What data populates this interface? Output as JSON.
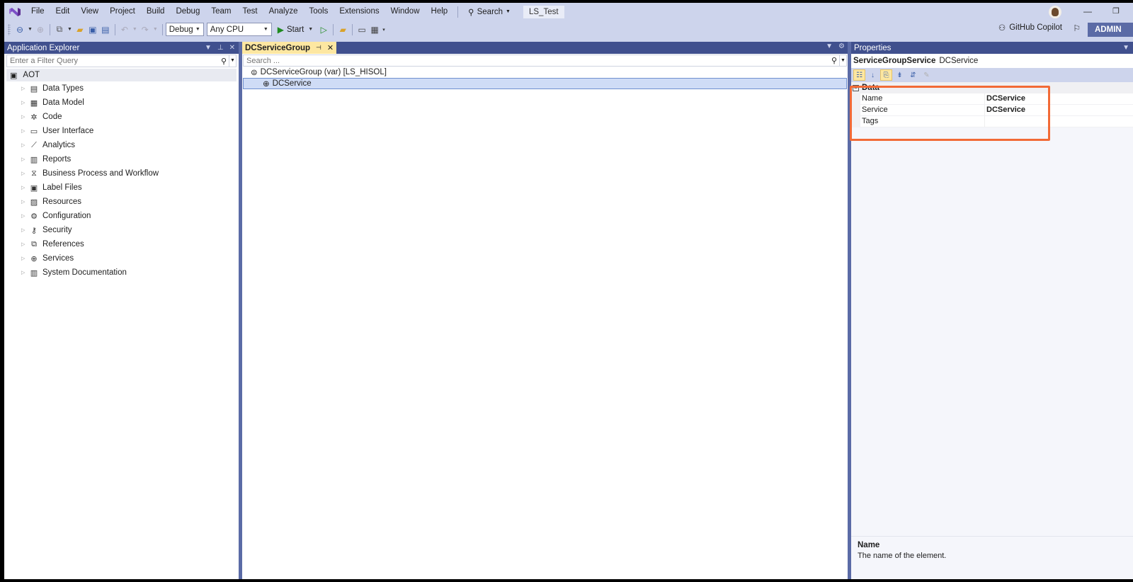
{
  "menubar": {
    "logo": "visual-studio-logo",
    "items": [
      "File",
      "Edit",
      "View",
      "Project",
      "Build",
      "Debug",
      "Team",
      "Test",
      "Analyze",
      "Tools",
      "Extensions",
      "Window",
      "Help"
    ],
    "search_label": "Search",
    "solution_name": "LS_Test",
    "minimize": "—",
    "restore": "❐"
  },
  "toolbar": {
    "config": "Debug",
    "platform": "Any CPU",
    "start_label": "Start",
    "copilot_label": "GitHub Copilot",
    "admin_label": "ADMIN"
  },
  "app_explorer": {
    "title": "Application Explorer",
    "filter_placeholder": "Enter a Filter Query",
    "root": "AOT",
    "items": [
      {
        "label": "Data Types",
        "icon": "data-types-icon"
      },
      {
        "label": "Data Model",
        "icon": "table-icon"
      },
      {
        "label": "Code",
        "icon": "code-icon"
      },
      {
        "label": "User Interface",
        "icon": "window-icon"
      },
      {
        "label": "Analytics",
        "icon": "analytics-icon"
      },
      {
        "label": "Reports",
        "icon": "report-icon"
      },
      {
        "label": "Business Process and Workflow",
        "icon": "workflow-icon"
      },
      {
        "label": "Label Files",
        "icon": "label-file-icon"
      },
      {
        "label": "Resources",
        "icon": "image-icon"
      },
      {
        "label": "Configuration",
        "icon": "gear-icon"
      },
      {
        "label": "Security",
        "icon": "key-icon"
      },
      {
        "label": "References",
        "icon": "references-icon"
      },
      {
        "label": "Services",
        "icon": "globe-icon"
      },
      {
        "label": "System Documentation",
        "icon": "books-icon"
      }
    ]
  },
  "editor": {
    "tab_label": "DCServiceGroup",
    "search_placeholder": "Search ...",
    "root_node": "DCServiceGroup (var) [LS_HISOL]",
    "child_node": "DCService"
  },
  "properties": {
    "title": "Properties",
    "object_type": "ServiceGroupService",
    "object_name": "DCService",
    "category": "Data",
    "rows": [
      {
        "name": "Name",
        "value": "DCService"
      },
      {
        "name": "Service",
        "value": "DCService"
      },
      {
        "name": "Tags",
        "value": ""
      }
    ],
    "desc_title": "Name",
    "desc_text": "The name of the element.",
    "highlight_color": "#f26a36"
  }
}
